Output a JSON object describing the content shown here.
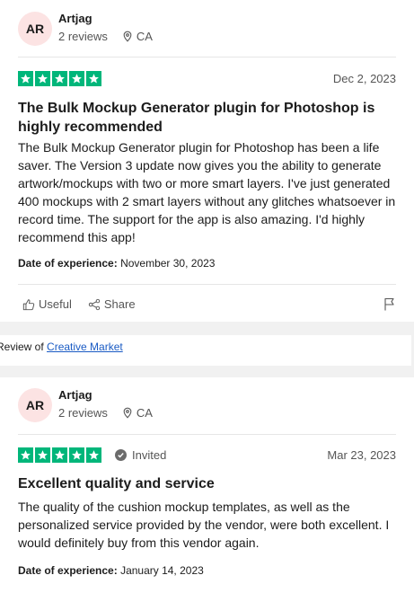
{
  "reviews": [
    {
      "avatar": "AR",
      "name": "Artjag",
      "review_count": "2 reviews",
      "location": "CA",
      "rating": 5,
      "invited_label": "",
      "date": "Dec 2, 2023",
      "title": "The Bulk Mockup Generator plugin for Photoshop is highly recommended",
      "body": "The Bulk Mockup Generator plugin for Photoshop has been a life saver. The Version 3 update now gives you the ability to generate artwork/mockups with two or more smart layers. I've just generated 400 mockups with 2 smart layers without any glitches whatsoever in record time. The support for the app is also amazing. I'd highly recommend this app!",
      "experience_label": "Date of experience:",
      "experience_date": "November 30, 2023",
      "useful_label": "Useful",
      "share_label": "Share"
    },
    {
      "avatar": "AR",
      "name": "Artjag",
      "review_count": "2 reviews",
      "location": "CA",
      "rating": 5,
      "invited_label": "Invited",
      "date": "Mar 23, 2023",
      "title": "Excellent quality and service",
      "body": "The quality of the cushion mockup templates, as well as the personalized service provided by the vendor, were both excellent. I would definitely buy from this vendor again.",
      "experience_label": "Date of experience:",
      "experience_date": "January 14, 2023"
    }
  ],
  "review_of": {
    "prefix": "Review of",
    "company": "Creative Market"
  },
  "colors": {
    "star_green": "#00b67a",
    "avatar_bg": "#fce3e3",
    "link": "#1a5bc4"
  },
  "icons": [
    "star-icon",
    "location-pin-icon",
    "thumbs-up-icon",
    "share-icon",
    "flag-icon",
    "check-icon"
  ]
}
